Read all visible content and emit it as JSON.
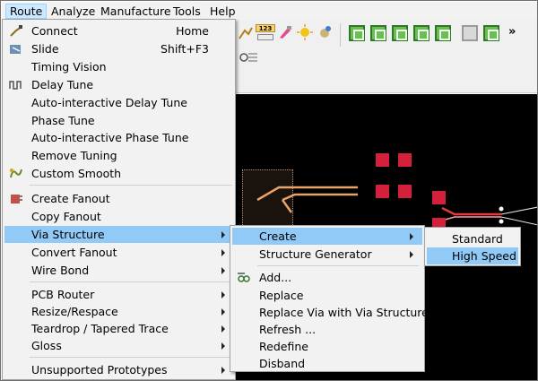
{
  "menubar": {
    "items": [
      "Route",
      "Analyze",
      "Manufacture",
      "Tools",
      "Help"
    ]
  },
  "toolbar": {
    "badge_number": "123",
    "overflow_symbol": "»"
  },
  "route_menu": {
    "items": [
      {
        "label": "Connect",
        "shortcut": "Home",
        "icon": "connect-icon"
      },
      {
        "label": "Slide",
        "shortcut": "Shift+F3",
        "icon": "slide-icon"
      },
      {
        "label": "Timing Vision"
      },
      {
        "label": "Delay Tune",
        "icon": "delay-tune-icon"
      },
      {
        "label": "Auto-interactive Delay Tune"
      },
      {
        "label": "Phase Tune"
      },
      {
        "label": "Auto-interactive Phase Tune"
      },
      {
        "label": "Remove Tuning"
      },
      {
        "label": "Custom Smooth",
        "icon": "custom-smooth-icon"
      },
      {
        "label": "Create Fanout",
        "icon": "create-fanout-icon"
      },
      {
        "label": "Copy Fanout"
      },
      {
        "label": "Via Structure",
        "submenu": true,
        "highlighted": true
      },
      {
        "label": "Convert Fanout",
        "submenu": true
      },
      {
        "label": "Wire Bond",
        "submenu": true
      },
      {
        "label": "PCB Router",
        "submenu": true
      },
      {
        "label": "Resize/Respace",
        "submenu": true
      },
      {
        "label": "Teardrop / Tapered Trace",
        "submenu": true
      },
      {
        "label": "Gloss",
        "submenu": true
      },
      {
        "label": "Unsupported Prototypes",
        "submenu": true
      }
    ]
  },
  "via_structure_menu": {
    "items": [
      {
        "label": "Create",
        "submenu": true,
        "highlighted": true
      },
      {
        "label": "Structure Generator",
        "submenu": true
      },
      {
        "label": "Add...",
        "icon": "add-via-icon"
      },
      {
        "label": "Replace"
      },
      {
        "label": "Replace Via with Via Structure"
      },
      {
        "label": "Refresh ..."
      },
      {
        "label": "Redefine"
      },
      {
        "label": "Disband"
      }
    ]
  },
  "create_menu": {
    "items": [
      {
        "label": "Standard"
      },
      {
        "label": "High Speed",
        "highlighted": true
      }
    ]
  },
  "colors": {
    "menu_highlight": "#91c9f7",
    "menubar_active": "#cde8ff",
    "pad_red": "#d4203a",
    "trace_copper": "#e8a36b",
    "canvas_bg": "#000000"
  }
}
